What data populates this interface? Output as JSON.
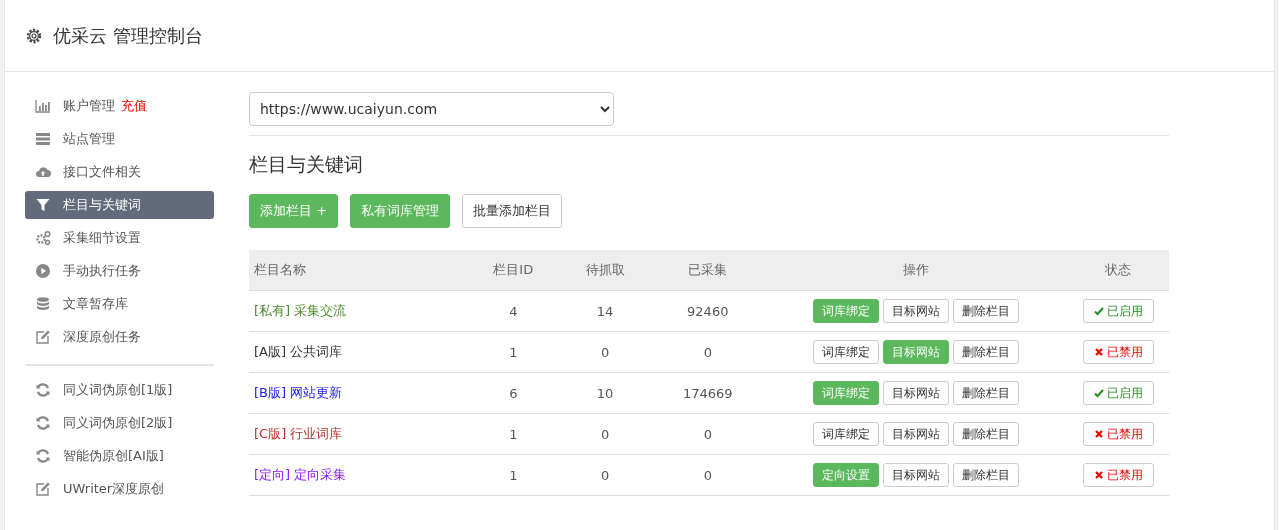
{
  "header": {
    "title": "优采云 管理控制台"
  },
  "sidebar": {
    "items": [
      {
        "label": "账户管理",
        "badge": "充值",
        "kind": "chart",
        "selected": false
      },
      {
        "label": "站点管理",
        "kind": "server",
        "selected": false
      },
      {
        "label": "接口文件相关",
        "kind": "cloud",
        "selected": false
      },
      {
        "label": "栏目与关键词",
        "kind": "filter",
        "selected": true
      },
      {
        "label": "采集细节设置",
        "kind": "gears",
        "selected": false
      },
      {
        "label": "手动执行任务",
        "kind": "play",
        "selected": false
      },
      {
        "label": "文章暂存库",
        "kind": "database",
        "selected": false
      },
      {
        "label": "深度原创任务",
        "kind": "edit",
        "selected": false
      }
    ],
    "tools": [
      {
        "label": "同义词伪原创[1版]",
        "kind": "refresh"
      },
      {
        "label": "同义词伪原创[2版]",
        "kind": "refresh"
      },
      {
        "label": "智能伪原创[AI版]",
        "kind": "refresh"
      },
      {
        "label": "UWriter深度原创",
        "kind": "edit"
      }
    ]
  },
  "site_select": {
    "value": "https://www.ucaiyun.com"
  },
  "section_title": "栏目与关键词",
  "toolbar": [
    {
      "label": "添加栏目 +",
      "highlighted": true
    },
    {
      "label": "私有词库管理",
      "highlighted": true
    },
    {
      "label": "批量添加栏目",
      "highlighted": false
    }
  ],
  "table": {
    "columns": [
      "栏目名称",
      "栏目ID",
      "待抓取",
      "已采集",
      "操作",
      "状态"
    ],
    "rows": [
      {
        "tag": "[私有]",
        "name": "采集交流",
        "color": "#4e8a2a",
        "id": "4",
        "pending": "14",
        "collected": "92460",
        "actions": [
          {
            "label": "词库绑定",
            "highlighted": true
          },
          {
            "label": "目标网站",
            "highlighted": false
          },
          {
            "label": "删除栏目",
            "highlighted": false
          }
        ],
        "enabled": true,
        "status": "已启用"
      },
      {
        "tag": "[A版]",
        "name": "公共词库",
        "color": "#333333",
        "id": "1",
        "pending": "0",
        "collected": "0",
        "actions": [
          {
            "label": "词库绑定",
            "highlighted": false
          },
          {
            "label": "目标网站",
            "highlighted": true
          },
          {
            "label": "删除栏目",
            "highlighted": false
          }
        ],
        "enabled": false,
        "status": "已禁用"
      },
      {
        "tag": "[B版]",
        "name": "网站更新",
        "color": "#1a1aff",
        "id": "6",
        "pending": "10",
        "collected": "174669",
        "actions": [
          {
            "label": "词库绑定",
            "highlighted": true
          },
          {
            "label": "目标网站",
            "highlighted": false
          },
          {
            "label": "删除栏目",
            "highlighted": false
          }
        ],
        "enabled": true,
        "status": "已启用"
      },
      {
        "tag": "[C版]",
        "name": "行业词库",
        "color": "#b8322c",
        "id": "1",
        "pending": "0",
        "collected": "0",
        "actions": [
          {
            "label": "词库绑定",
            "highlighted": false
          },
          {
            "label": "目标网站",
            "highlighted": false
          },
          {
            "label": "删除栏目",
            "highlighted": false
          }
        ],
        "enabled": false,
        "status": "已禁用"
      },
      {
        "tag": "[定向]",
        "name": "定向采集",
        "color": "#8a1aff",
        "id": "1",
        "pending": "0",
        "collected": "0",
        "actions": [
          {
            "label": "定向设置",
            "highlighted": true
          },
          {
            "label": "目标网站",
            "highlighted": false
          },
          {
            "label": "删除栏目",
            "highlighted": false
          }
        ],
        "enabled": false,
        "status": "已禁用"
      }
    ]
  }
}
